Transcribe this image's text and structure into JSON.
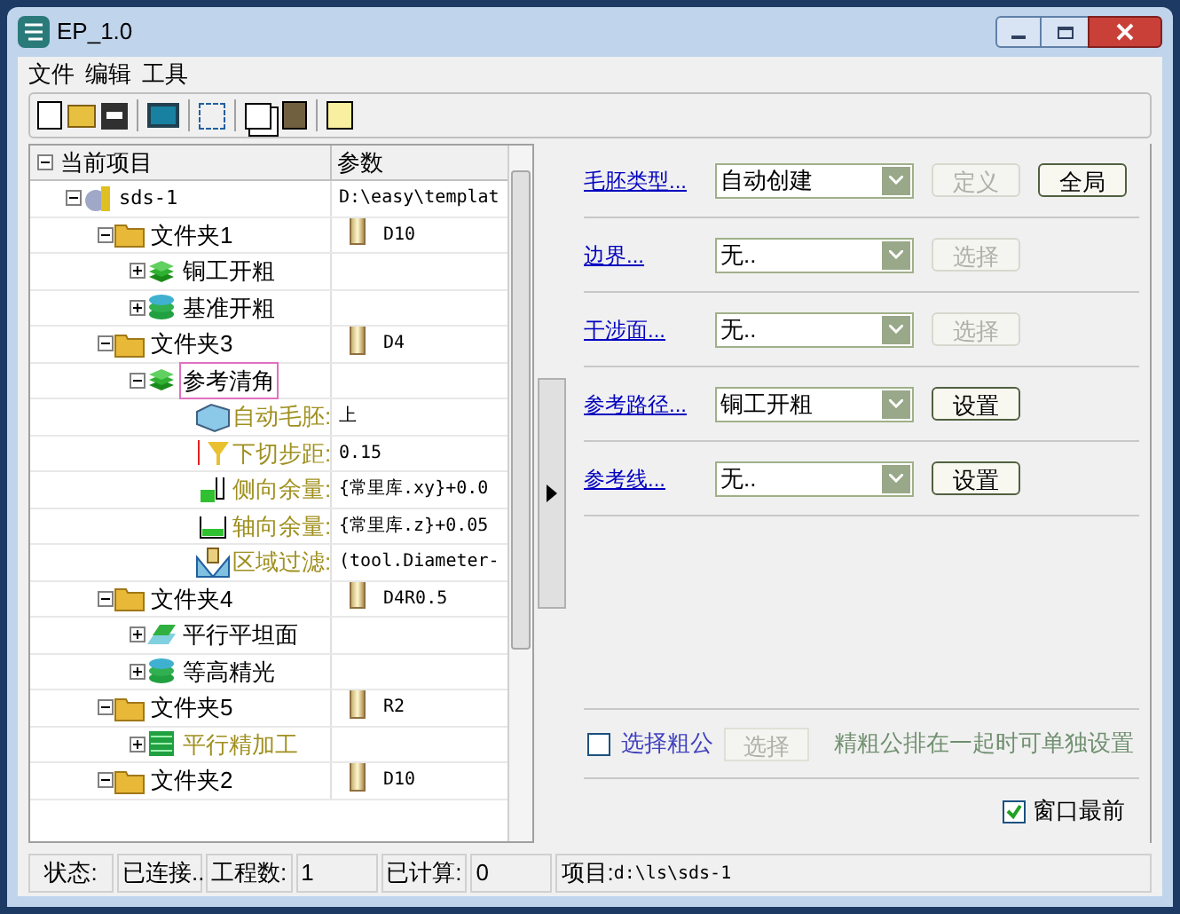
{
  "window": {
    "title": "EP_1.0"
  },
  "menu": [
    "文件",
    "编辑",
    "工具"
  ],
  "tree": {
    "columns": [
      "当前项目",
      "参数"
    ],
    "root_expanded": true,
    "items": [
      {
        "kind": "project",
        "label": "sds-1",
        "param": "D:\\easy\\templat",
        "expanded": true,
        "children": [
          {
            "kind": "folder",
            "label": "文件夹1",
            "param": "D10",
            "expanded": true,
            "children": [
              {
                "kind": "stack",
                "label": "铜工开粗",
                "expanded": false,
                "selected": false,
                "inactive": false
              },
              {
                "kind": "disks",
                "label": "基准开粗",
                "expanded": false,
                "selected": false,
                "inactive": false
              }
            ]
          },
          {
            "kind": "folder",
            "label": "文件夹3",
            "param": "D4",
            "expanded": true,
            "children": [
              {
                "kind": "stack",
                "label": "参考清角",
                "expanded": true,
                "selected": true,
                "inactive": false,
                "children": [
                  {
                    "kind": "block",
                    "label": "自动毛胚:",
                    "value": "上"
                  },
                  {
                    "kind": "step",
                    "label": "下切步距:",
                    "value": "0.15"
                  },
                  {
                    "kind": "side",
                    "label": "侧向余量:",
                    "value": "{常里库.xy}+0.0"
                  },
                  {
                    "kind": "axial",
                    "label": "轴向余量:",
                    "value": "{常里库.z}+0.05"
                  },
                  {
                    "kind": "filter",
                    "label": "区域过滤:",
                    "value": "(tool.Diameter-"
                  }
                ]
              }
            ]
          },
          {
            "kind": "folder",
            "label": "文件夹4",
            "param": "D4R0.5",
            "expanded": true,
            "children": [
              {
                "kind": "flat",
                "label": "平行平坦面",
                "expanded": false,
                "selected": false,
                "inactive": false
              },
              {
                "kind": "disks",
                "label": "等高精光",
                "expanded": false,
                "selected": false,
                "inactive": false
              }
            ]
          },
          {
            "kind": "folder",
            "label": "文件夹5",
            "param": "R2",
            "expanded": true,
            "children": [
              {
                "kind": "lines",
                "label": "平行精加工",
                "expanded": false,
                "selected": false,
                "inactive": true
              }
            ]
          },
          {
            "kind": "folder",
            "label": "文件夹2",
            "param": "D10",
            "expanded": true
          }
        ]
      }
    ]
  },
  "settings": [
    {
      "label": "毛胚类型...",
      "value": "自动创建",
      "buttons": [
        {
          "label": "定义",
          "disabled": true
        },
        {
          "label": "全局",
          "disabled": false
        }
      ]
    },
    {
      "label": "边界...",
      "value": "无..",
      "buttons": [
        {
          "label": "选择",
          "disabled": true
        }
      ]
    },
    {
      "label": "干涉面...",
      "value": "无..",
      "buttons": [
        {
          "label": "选择",
          "disabled": true
        }
      ]
    },
    {
      "label": "参考路径...",
      "value": "铜工开粗",
      "buttons": [
        {
          "label": "设置",
          "disabled": false
        }
      ]
    },
    {
      "label": "参考线...",
      "value": "无..",
      "buttons": [
        {
          "label": "设置",
          "disabled": false
        }
      ]
    }
  ],
  "rough_select": {
    "label": "选择粗公",
    "checked": false,
    "button": {
      "label": "选择",
      "disabled": true
    },
    "note": "精粗公排在一起时可单独设置"
  },
  "always_on_top": {
    "label": "窗口最前",
    "checked": true
  },
  "status_bar": [
    {
      "label": "状态:",
      "value": "已连接.."
    },
    {
      "label": "工程数:",
      "value": "1"
    },
    {
      "label": "已计算:",
      "value": "0"
    },
    {
      "label": "项目:",
      "value": "d:\\ls\\sds-1"
    }
  ]
}
